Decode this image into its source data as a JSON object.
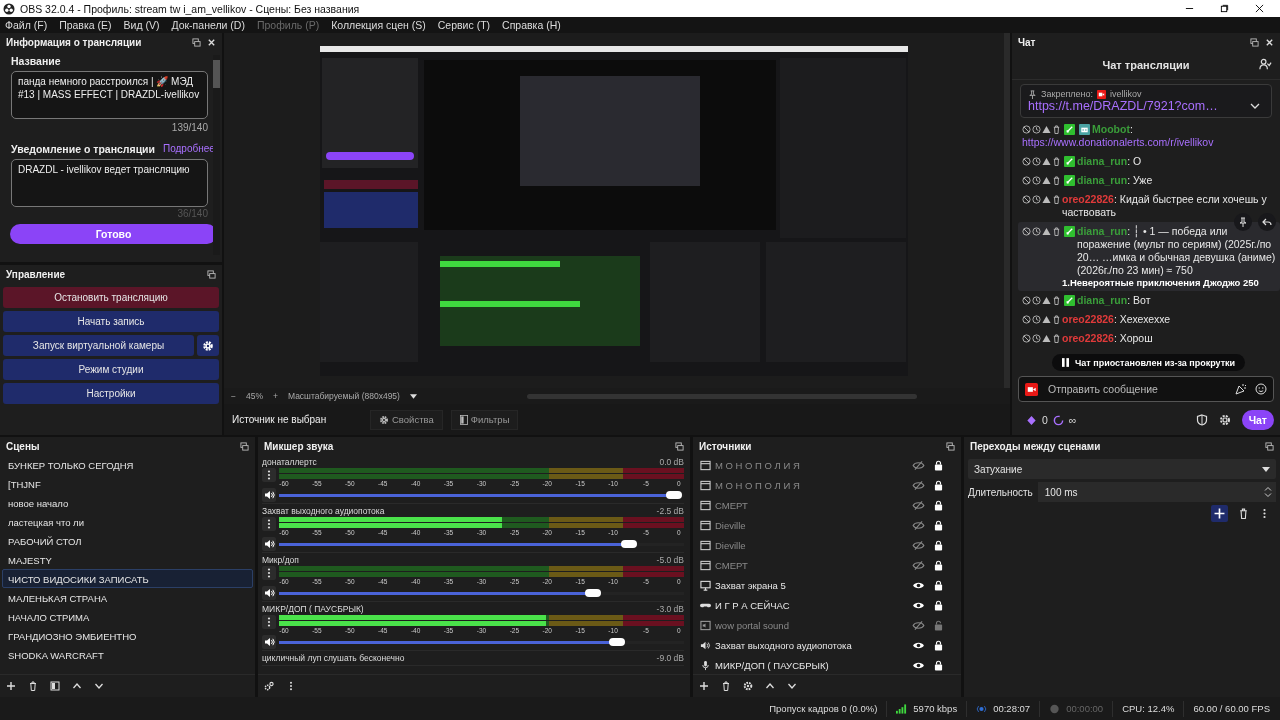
{
  "window": {
    "title": "OBS 32.0.4 - Профиль: stream tw i_am_vellikov - Сцены: Без названия"
  },
  "menu": [
    {
      "label": "Файл (F)",
      "disabled": false
    },
    {
      "label": "Правка (E)",
      "disabled": false
    },
    {
      "label": "Вид (V)",
      "disabled": false
    },
    {
      "label": "Док-панели (D)",
      "disabled": false
    },
    {
      "label": "Профиль (P)",
      "disabled": true
    },
    {
      "label": "Коллекция сцен (S)",
      "disabled": false
    },
    {
      "label": "Сервис (T)",
      "disabled": false
    },
    {
      "label": "Справка (H)",
      "disabled": false
    }
  ],
  "stream_info": {
    "title": "Информация о трансляции",
    "name_label": "Название",
    "name_value": "панда немного расстроился | 🚀 МЭД #13 | MASS EFFECT | DRAZDL-ivellikov",
    "name_count": "139/140",
    "notice_label": "Уведомление о трансляции",
    "notice_link": "Подробнее",
    "notice_value": "DRAZDL - ivellikov ведет трансляцию",
    "notice_count": "36/140",
    "done_button": "Готово"
  },
  "controls": {
    "title": "Управление",
    "buttons": [
      {
        "label": "Остановить трансляцию",
        "kind": "stop"
      },
      {
        "label": "Начать запись",
        "kind": "normal"
      },
      {
        "label": "Запуск виртуальной камеры",
        "kind": "settings"
      },
      {
        "label": "Режим студии",
        "kind": "normal"
      },
      {
        "label": "Настройки",
        "kind": "normal"
      }
    ]
  },
  "preview": {
    "zoom_minus": "−",
    "zoom": "45%",
    "zoom_plus": "+",
    "scale_mode": "Масштабируемый (880x495)"
  },
  "source_bar": {
    "status": "Источник не выбран",
    "properties": "Свойства",
    "filters": "Фильтры"
  },
  "chat": {
    "dock_title": "Чат",
    "title": "Чат трансляции",
    "pinned": {
      "label": "Закреплено:",
      "user": "ivellikov",
      "text": "https://t.me/DRAZDL/7921?com…"
    },
    "messages": [
      {
        "user": "Moobot",
        "color": "#3a9d3a",
        "badges": [
          {
            "kind": "vip"
          },
          {
            "kind": "bot"
          }
        ],
        "sep": ":",
        "text": "https://www.donationalerts.com/r/ivellikov",
        "kind": "link",
        "hovered": false
      },
      {
        "user": "diana_run",
        "color": "#3a9d3a",
        "badges": [
          {
            "kind": "vip"
          }
        ],
        "sep": ":",
        "text": "О",
        "kind": "text",
        "hovered": false
      },
      {
        "user": "diana_run",
        "color": "#3a9d3a",
        "badges": [
          {
            "kind": "vip"
          }
        ],
        "sep": ":",
        "text": "Уже",
        "kind": "text",
        "hovered": false
      },
      {
        "user": "oreo22826",
        "color": "#e03a3a",
        "sep": ":",
        "text": "Кидай быстрее если хочешь у частвовать",
        "kind": "text",
        "hovered": false
      },
      {
        "user": "diana_run",
        "color": "#3a9d3a",
        "badges": [
          {
            "kind": "vip"
          }
        ],
        "sep": ":",
        "text": "┆ • 1 — победа или поражение (мульт по сериям) (2025г./по 20… …имка и обычная девушка (аниме)(2026г./по 23 мин) ≈ 750",
        "kind": "text",
        "hovered": true,
        "overlay": "1.Невероятные приключения Джоджо 250"
      },
      {
        "user": "diana_run",
        "color": "#3a9d3a",
        "badges": [
          {
            "kind": "vip"
          }
        ],
        "sep": ":",
        "text": "Вот",
        "kind": "text",
        "hovered": false
      },
      {
        "user": "oreo22826",
        "color": "#e03a3a",
        "sep": ":",
        "text": "Хехехеххе",
        "kind": "text",
        "hovered": false
      },
      {
        "user": "oreo22826",
        "color": "#e03a3a",
        "sep": ":",
        "text": "Хорош",
        "kind": "text",
        "hovered": false
      }
    ],
    "paused_notice": "Чат приостановлен из-за прокрутки",
    "input_placeholder": "Отправить сообщение",
    "points": "0",
    "streak": "∞",
    "send_button": "Чат"
  },
  "scenes": {
    "title": "Сцены",
    "items": [
      {
        "name": "БУНКЕР ТОЛЬКО СЕГОДНЯ",
        "selected": false
      },
      {
        "name": "[THJNF",
        "selected": false
      },
      {
        "name": "новое начало",
        "selected": false
      },
      {
        "name": "ластецкая что ли",
        "selected": false
      },
      {
        "name": "РАБОЧИЙ СТОЛ",
        "selected": false
      },
      {
        "name": "MAJESTY",
        "selected": false
      },
      {
        "name": "ЧИСТО ВИДОСИКИ ЗАПИСАТЬ",
        "selected": true
      },
      {
        "name": "МАЛЕНЬКАЯ СТРАНА",
        "selected": false
      },
      {
        "name": "НАЧАЛО СТРИМА",
        "selected": false
      },
      {
        "name": "ГРАНДИОЗНО ЭМБИЕНТНО",
        "selected": false
      },
      {
        "name": "SHODKA WARCRAFT",
        "selected": false
      }
    ]
  },
  "mixer": {
    "title": "Микшер звука",
    "channels": [
      {
        "name": "донаталлертс",
        "reading": "0.0 dB",
        "meter": {
          "level": 0
        },
        "volume": {
          "level": 0.99
        },
        "scale": [
          "-60",
          "-55",
          "-50",
          "-45",
          "-40",
          "-35",
          "-30",
          "-25",
          "-20",
          "-15",
          "-10",
          "-5",
          "0"
        ]
      },
      {
        "name": "Захват выходного аудиопотока",
        "reading": "-2.5 dB",
        "meter": {
          "level": 0.55
        },
        "volume": {
          "level": 0.88
        },
        "scale": [
          "-60",
          "-55",
          "-50",
          "-45",
          "-40",
          "-35",
          "-30",
          "-25",
          "-20",
          "-15",
          "-10",
          "-5",
          "0"
        ]
      },
      {
        "name": "Микр/доп",
        "reading": "-5.0 dB",
        "meter": {
          "level": 0
        },
        "volume": {
          "level": 0.79
        },
        "scale": [
          "-60",
          "-55",
          "-50",
          "-45",
          "-40",
          "-35",
          "-30",
          "-25",
          "-20",
          "-15",
          "-10",
          "-5",
          "0"
        ]
      },
      {
        "name": "МИКР/ДОП ( ПАУСБРЫК)",
        "reading": "-3.0 dB",
        "meter": {
          "level": 0.66
        },
        "volume": {
          "level": 0.85
        },
        "scale": [
          "-60",
          "-55",
          "-50",
          "-45",
          "-40",
          "-35",
          "-30",
          "-25",
          "-20",
          "-15",
          "-10",
          "-5",
          "0"
        ]
      },
      {
        "name": "цикличный луп слушать бесконечно",
        "reading": "-9.0 dB"
      }
    ]
  },
  "sources": {
    "title": "Источники",
    "items": [
      {
        "name": "М О Н О П О Л И Я",
        "kind": "window",
        "visible": false,
        "locked": true
      },
      {
        "name": "М О Н О П О Л И Я",
        "kind": "window",
        "visible": false,
        "locked": true
      },
      {
        "name": "СМЕРТ",
        "kind": "window",
        "visible": false,
        "locked": true
      },
      {
        "name": "Dieville",
        "kind": "window",
        "visible": false,
        "locked": true
      },
      {
        "name": "Dieville",
        "kind": "window",
        "visible": false,
        "locked": true
      },
      {
        "name": "СМЕРТ",
        "kind": "window",
        "visible": false,
        "locked": true
      },
      {
        "name": "Захват экрана 5",
        "kind": "monitor",
        "visible": true,
        "locked": true
      },
      {
        "name": "И Г Р А  СЕЙЧАС",
        "kind": "gamepad",
        "visible": true,
        "locked": true
      },
      {
        "name": "wow portal sound",
        "kind": "audio-window",
        "visible": false,
        "locked": false
      },
      {
        "name": "Захват выходного аудиопотока",
        "kind": "speaker",
        "visible": true,
        "locked": true
      },
      {
        "name": "МИКР/ДОП ( ПАУСБРЫК)",
        "kind": "mic",
        "visible": true,
        "locked": true
      }
    ]
  },
  "transitions": {
    "title": "Переходы между сценами",
    "selected": "Затухание",
    "duration_label": "Длительность",
    "duration": "100 ms"
  },
  "status_bar": {
    "dropped": "Пропуск кадров 0 (0.0%)",
    "bitrate": "5970 kbps",
    "live_time": "00:28:07",
    "rec_time": "00:00:00",
    "cpu": "CPU: 12.4%",
    "fps": "60.00 / 60.00 FPS"
  }
}
